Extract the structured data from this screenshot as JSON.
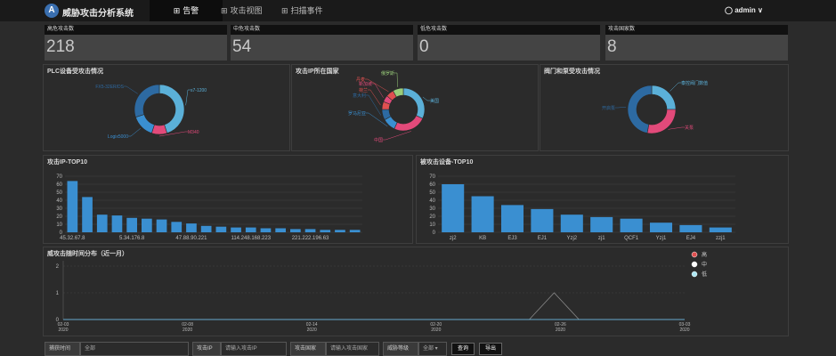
{
  "header": {
    "logo_letter": "A",
    "title": "威胁攻击分析系统",
    "tabs": [
      {
        "label": "告警",
        "icon": "grid-icon"
      },
      {
        "label": "攻击视图",
        "icon": "grid-icon"
      },
      {
        "label": "扫描事件",
        "icon": "grid-icon"
      }
    ],
    "user": "admin",
    "user_icon": "user-icon",
    "caret": "∨"
  },
  "kpis": [
    {
      "label": "高危攻击数",
      "value": "218"
    },
    {
      "label": "中危攻击数",
      "value": "54"
    },
    {
      "label": "低危攻击数",
      "value": "0"
    },
    {
      "label": "攻击国家数",
      "value": "8"
    }
  ],
  "panels": {
    "plc": {
      "title": "PLC设备受攻击情况"
    },
    "country": {
      "title": "攻击IP所在国家"
    },
    "valve": {
      "title": "阀门和泵受攻击情况"
    },
    "top_ip": {
      "title": "攻击IP-TOP10"
    },
    "top_dev": {
      "title": "被攻击设备-TOP10"
    },
    "timeline": {
      "title": "威攻击随时间分布（近一月）"
    }
  },
  "colors": {
    "blue": "#3a8fd1",
    "light_blue": "#5bb0d8",
    "dark_blue": "#2d6aa2",
    "pink": "#e24a7a",
    "red": "#e05050",
    "green": "#9acd7a"
  },
  "chart_data": [
    {
      "type": "pie",
      "title": "PLC设备受攻击情况",
      "slices": [
        {
          "label": "s7-1200",
          "value": 45
        },
        {
          "label": "M340",
          "value": 10
        },
        {
          "label": "Logix5000",
          "value": 15
        },
        {
          "label": "FX5-32ER/DS",
          "value": 30
        }
      ]
    },
    {
      "type": "pie",
      "title": "攻击IP所在国家",
      "slices": [
        {
          "label": "美国",
          "value": 32
        },
        {
          "label": "中国",
          "value": 25
        },
        {
          "label": "罗马尼亚",
          "value": 10
        },
        {
          "label": "意大利",
          "value": 8
        },
        {
          "label": "荷兰",
          "value": 6
        },
        {
          "label": "新加坡",
          "value": 5
        },
        {
          "label": "丹麦",
          "value": 6
        },
        {
          "label": "俄罗斯",
          "value": 8
        }
      ]
    },
    {
      "type": "pie",
      "title": "阀门和泵受攻击情况",
      "slices": [
        {
          "label": "泰控阀门数值",
          "value": 25
        },
        {
          "label": "关泵",
          "value": 28
        },
        {
          "label": "开启泵",
          "value": 47
        }
      ]
    },
    {
      "type": "bar",
      "title": "攻击IP-TOP10",
      "tick_labels": [
        "45.32.67.8",
        "5.34.176.8",
        "47.88.90.221",
        "114.248.168.223",
        "221.222.196.63"
      ],
      "values": [
        64,
        44,
        22,
        21,
        18,
        17,
        16,
        13,
        11,
        8,
        7,
        6,
        6,
        5,
        5,
        4,
        4,
        3,
        3,
        3
      ],
      "yticks": [
        0,
        10,
        20,
        30,
        40,
        50,
        60,
        70
      ],
      "ylim": [
        0,
        70
      ]
    },
    {
      "type": "bar",
      "title": "被攻击设备-TOP10",
      "categories": [
        "zj2",
        "KB",
        "EJ3",
        "EJ1",
        "Yzj2",
        "zj1",
        "QCF1",
        "Yzj1",
        "EJ4",
        "zzj1"
      ],
      "values": [
        60,
        45,
        34,
        29,
        22,
        19,
        17,
        12,
        9,
        6
      ],
      "yticks": [
        0,
        10,
        20,
        30,
        40,
        50,
        60,
        70
      ],
      "ylim": [
        0,
        70
      ]
    },
    {
      "type": "line",
      "title": "威攻击随时间分布（近一月）",
      "x_ticks": [
        "02-03\n2020",
        "02-08\n2020",
        "02-14\n2020",
        "02-20\n2020",
        "02-26\n2020",
        "03-03\n2020"
      ],
      "yticks": [
        0,
        1,
        2
      ],
      "ylim": [
        0,
        2
      ],
      "series": [
        {
          "name": "高",
          "points": [
            [
              0,
              0
            ],
            [
              0.75,
              0
            ],
            [
              0.79,
              1
            ],
            [
              0.83,
              0
            ],
            [
              1,
              0
            ]
          ]
        },
        {
          "name": "中",
          "points": [
            [
              0,
              0
            ],
            [
              1,
              0
            ]
          ]
        },
        {
          "name": "低",
          "points": [
            [
              0,
              0
            ],
            [
              1,
              0
            ]
          ]
        }
      ]
    }
  ],
  "filters": {
    "time_label": "捕获时间",
    "time_value": "全部",
    "ip_label": "攻击IP",
    "ip_placeholder": "请输入攻击IP",
    "country_label": "攻击国家",
    "country_placeholder": "请输入攻击国家",
    "level_label": "威胁等级",
    "level_value": "全部",
    "query_label": "查询",
    "export_label": "导出"
  }
}
